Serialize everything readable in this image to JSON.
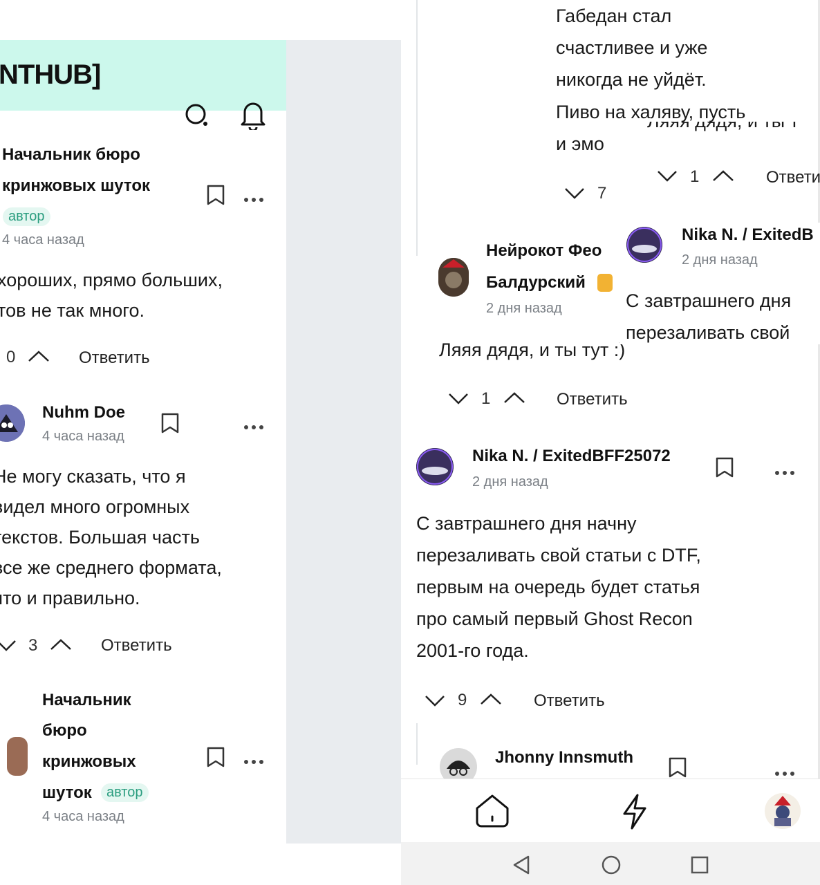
{
  "left": {
    "header": {
      "logo": "NTHUB]"
    },
    "comments": [
      {
        "author_line1": "Начальник бюро",
        "author_line2": "кринжовых шуток",
        "badge": "автор",
        "time": "4 часа назад",
        "text_lines": [
          "хороших, прямо больших,",
          "тов не так много."
        ],
        "votes": "0",
        "reply": "Ответить"
      },
      {
        "author": "Nuhm Doe",
        "time": "4 часа назад",
        "text_lines": [
          "Не могу сказать, что я",
          "видел много огромных",
          "текстов. Большая часть",
          "все же среднего формата,",
          "что и правильно."
        ],
        "votes": "3",
        "reply": "Ответить"
      },
      {
        "author_lines": [
          "Начальник",
          "бюро",
          "кринжовых",
          "шуток"
        ],
        "badge": "автор",
        "time": "4 часа назад"
      }
    ]
  },
  "right": {
    "top_text": [
      "Габедан стал",
      "счастливее и уже",
      "никогда не уйдёт.",
      "Пиво на халяву, пусть",
      "и эмо"
    ],
    "top_votes": "7",
    "overlay1": {
      "text": "Ляяя дядя, и ты т",
      "votes": "1",
      "reply": "Ответи"
    },
    "overlay2": {
      "author": "Nika N. / ExitedB",
      "time": "2 дня назад",
      "text_lines": [
        "С завтрашнего дня",
        "перезаливать свой"
      ]
    },
    "reply_comment": {
      "author_line1": "Нейрокот Фео",
      "author_line2": "Балдурский",
      "time": "2 дня назад",
      "text": "Ляяя дядя, и ты тут :)",
      "votes": "1",
      "reply": "Ответить"
    },
    "main_comment": {
      "author": "Nika N. / ExitedBFF25072",
      "time": "2 дня назад",
      "text_lines": [
        "С завтрашнего дня начну",
        "перезаливать свой статьи с DTF,",
        "первым на очередь будет статья",
        "про самый первый Ghost Recon",
        "2001-го года."
      ],
      "votes": "9",
      "reply": "Ответить"
    },
    "next_comment": {
      "author": "Jhonny Innsmuth"
    }
  },
  "icons": [
    "search-icon",
    "bell-icon",
    "bookmark-icon",
    "more-icon",
    "vote-down-icon",
    "vote-up-icon",
    "home-icon",
    "lightning-icon",
    "back-icon",
    "circle-home-icon",
    "recents-icon"
  ],
  "colors": {
    "header_bg": "#ccf8ec",
    "badge_text": "#2a9d7f",
    "gap_bg": "#e9ecef"
  }
}
